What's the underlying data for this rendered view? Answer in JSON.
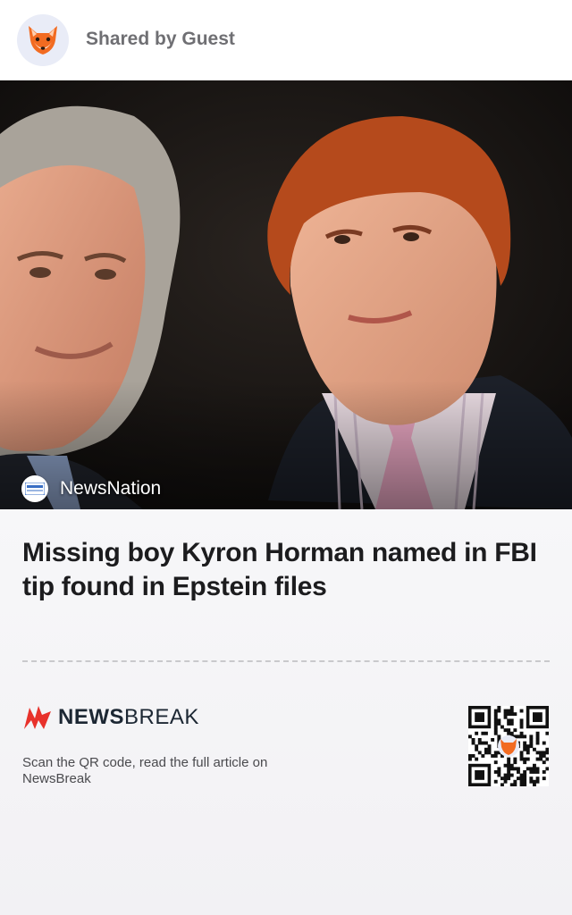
{
  "header": {
    "shared_by": "Shared by Guest",
    "avatar_icon": "fox-icon"
  },
  "hero": {
    "image": "photo of two men in suits",
    "source_icon": "newsnation-logo-icon",
    "source_name": "NewsNation"
  },
  "article": {
    "headline": "Missing boy Kyron Horman named in FBI tip found in Epstein files"
  },
  "footer": {
    "brand_icon": "newsbreak-logo-icon",
    "brand_bold": "NEWS",
    "brand_light": "BREAK",
    "scan_text": "Scan the QR code, read the full article on NewsBreak",
    "qr_icon": "qr-code-icon"
  },
  "colors": {
    "brand_red": "#e8322b",
    "fox_orange": "#f26b21",
    "header_text": "#6f6f73",
    "card_bg": "#f5f5f7"
  }
}
